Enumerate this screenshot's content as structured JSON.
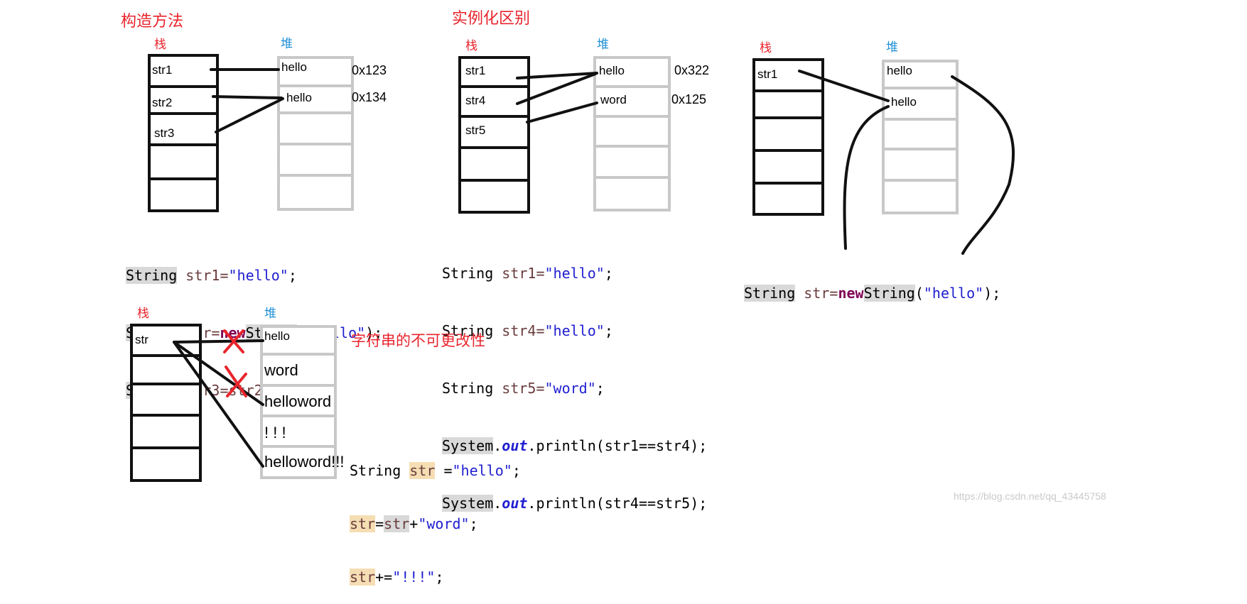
{
  "sections": {
    "constructor": {
      "title": "构造方法",
      "stack_label": "栈",
      "heap_label": "堆",
      "stack_cells": [
        "str1",
        "str2",
        "str3",
        "",
        ""
      ],
      "heap_cells": [
        "hello",
        "hello",
        "",
        "",
        ""
      ],
      "addresses": [
        "0x123",
        "0x134"
      ],
      "code": [
        {
          "type": "String",
          "rest": "str1=",
          "strval": "\"hello\"",
          "end": ";"
        },
        {
          "type": "String",
          "rest": "str=",
          "new": "new",
          "type2": "String",
          "open": "(",
          "strval": "\"hello\"",
          "end": ");"
        },
        {
          "type": "String",
          "rest": "str3=str2",
          "end": ";"
        }
      ]
    },
    "instantiation": {
      "title": "实例化区别",
      "stack_label": "栈",
      "heap_label": "堆",
      "stack_cells": [
        "str1",
        "str4",
        "str5",
        "",
        ""
      ],
      "heap_cells": [
        "hello",
        "word",
        "",
        "",
        ""
      ],
      "addresses": [
        "0x322",
        "0x125"
      ],
      "code": [
        {
          "type": "String",
          "rest": "str1=",
          "strval": "\"hello\"",
          "end": ";"
        },
        {
          "type": "String",
          "rest": "str4=",
          "strval": "\"hello\"",
          "end": ";"
        },
        {
          "type": "String",
          "rest": "str5=",
          "strval": "\"word\"",
          "end": ";"
        },
        {
          "sys": "System",
          "dot": ".",
          "out": "out",
          "rest": ".println(str1==str4);"
        },
        {
          "sys": "System",
          "dot": ".",
          "out": "out",
          "rest": ".println(str4==str5);"
        }
      ]
    },
    "new_string": {
      "stack_label": "栈",
      "heap_label": "堆",
      "stack_cells": [
        "str1",
        "",
        "",
        "",
        ""
      ],
      "heap_cells": [
        "hello",
        "hello",
        "",
        "",
        ""
      ],
      "code": {
        "type": "String",
        "rest": "str=",
        "new": "new",
        "type2": "String",
        "open": "(",
        "strval": "\"hello\"",
        "end": ");"
      }
    },
    "immutability": {
      "title": "字符串的不可更改性",
      "stack_label": "栈",
      "heap_label": "堆",
      "stack_cells": [
        "str",
        "",
        "",
        "",
        ""
      ],
      "heap_cells": [
        "hello",
        "word",
        "helloword",
        "! ! !",
        "helloword!!!"
      ],
      "code": [
        {
          "a": "String ",
          "b": "str",
          "c": " =",
          "d": "\"hello\"",
          "e": ";"
        },
        {
          "a": "str",
          "b": "=",
          "c": "str",
          "d": "+",
          "e": "\"word\"",
          "f": ";"
        },
        {
          "a": "str",
          "b": "+=",
          "c": "\"!!!\"",
          "d": ";"
        }
      ]
    }
  },
  "watermark": "https://blog.csdn.net/qq_43445758",
  "colors": {
    "title_red": "#e8242c",
    "heap_label_blue": "#1e90d6",
    "heap_border": "#c8c8c8",
    "cross_red": "#e8242c"
  }
}
